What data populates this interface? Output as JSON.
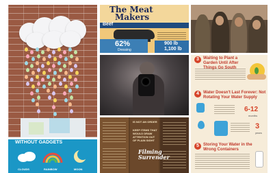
{
  "gallery": {
    "meat": {
      "title_line1": "The Meat",
      "title_line2": "Makers",
      "band_label": "Beef",
      "percent": "62%",
      "sub_label": "Dressing",
      "stat1": "900 lb",
      "stat2": "1,100 lb"
    },
    "water": {
      "step1_num": "3",
      "step1_heading": "Waiting to Plant a Garden Until After Things Go South",
      "step2_num": "4",
      "step2_heading": "Water Doesn't Last Forever: Not Rotating Your Water Supply",
      "step2_value_a": "6-12",
      "step2_unit_a": "months",
      "step2_value_b": "3",
      "step2_unit_b": "years",
      "step3_num": "5",
      "step3_heading": "Storing Your Water in the Wrong Containers"
    },
    "brown": {
      "col1_text": "IS NOT AN ORDER",
      "col2_text": "KEEP ITEMS THAT WOULD DRAW ATTENTION OUT OF PLAIN SIGHT",
      "filming_line1": "Filming",
      "filming_line2": "Surrender"
    },
    "gadgets": {
      "title": "WITHOUT GADGETS",
      "label1": "CLOUDS",
      "label2": "RAINBOW",
      "label3": "MOON"
    }
  }
}
